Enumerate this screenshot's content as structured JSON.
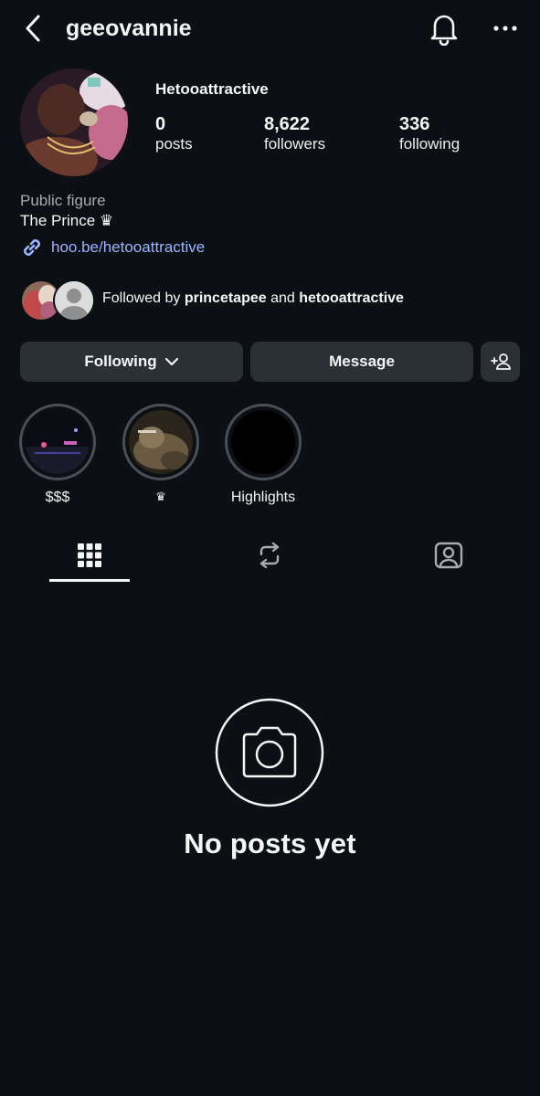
{
  "header": {
    "username": "geeovannie",
    "icons": [
      "back-chevron-icon",
      "bell-icon",
      "more-horizontal-icon"
    ]
  },
  "profile": {
    "display_name": "Hetooattractive",
    "stats": [
      {
        "value": "0",
        "label": "posts"
      },
      {
        "value": "8,622",
        "label": "followers"
      },
      {
        "value": "336",
        "label": "following"
      }
    ],
    "category": "Public figure",
    "bio": "The Prince ♛",
    "link": "hoo.be/hetooattractive"
  },
  "followed_by": {
    "prefix": "Followed by ",
    "user1": "princetapee",
    "conj": " and ",
    "user2": "hetooattractive"
  },
  "actions": {
    "following_label": "Following",
    "message_label": "Message"
  },
  "highlights": [
    {
      "caption": "$$$"
    },
    {
      "caption": "♛"
    },
    {
      "caption": "Highlights"
    }
  ],
  "tabs": [
    "grid-icon",
    "repost-icon",
    "tagged-person-icon"
  ],
  "empty_state": {
    "text": "No posts yet",
    "icon": "camera-icon"
  },
  "colors": {
    "background": "#0c0f14",
    "button": "#2b2f36",
    "link": "#9db4ff",
    "muted": "#a7abb2"
  }
}
